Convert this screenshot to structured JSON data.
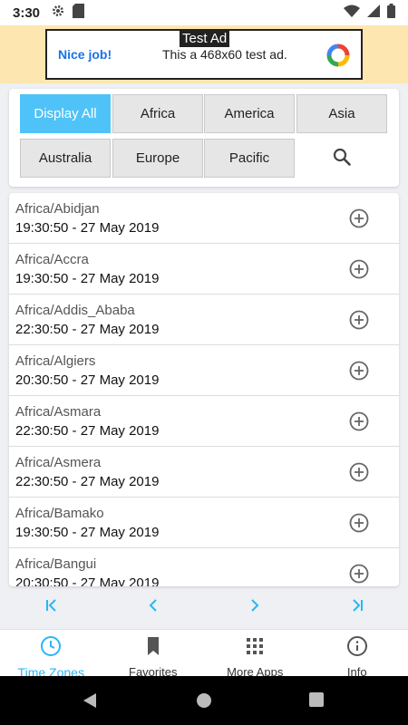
{
  "status_bar": {
    "time": "3:30"
  },
  "ad": {
    "label": "Test Ad",
    "headline": "Nice job!",
    "body": "This a 468x60 test ad."
  },
  "filters": {
    "buttons": [
      {
        "label": "Display All",
        "active": true
      },
      {
        "label": "Africa",
        "active": false
      },
      {
        "label": "America",
        "active": false
      },
      {
        "label": "Asia",
        "active": false
      },
      {
        "label": "Australia",
        "active": false
      },
      {
        "label": "Europe",
        "active": false
      },
      {
        "label": "Pacific",
        "active": false
      }
    ],
    "search_icon": "search-icon"
  },
  "timezones": [
    {
      "name": "Africa/Abidjan",
      "time": "19:30:50 - 27 May 2019"
    },
    {
      "name": "Africa/Accra",
      "time": "19:30:50 - 27 May 2019"
    },
    {
      "name": "Africa/Addis_Ababa",
      "time": "22:30:50 - 27 May 2019"
    },
    {
      "name": "Africa/Algiers",
      "time": "20:30:50 - 27 May 2019"
    },
    {
      "name": "Africa/Asmara",
      "time": "22:30:50 - 27 May 2019"
    },
    {
      "name": "Africa/Asmera",
      "time": "22:30:50 - 27 May 2019"
    },
    {
      "name": "Africa/Bamako",
      "time": "19:30:50 - 27 May 2019"
    },
    {
      "name": "Africa/Bangui",
      "time": "20:30:50 - 27 May 2019"
    }
  ],
  "pager": {
    "icons": [
      "first-page-icon",
      "previous-page-icon",
      "next-page-icon",
      "last-page-icon"
    ]
  },
  "bottom_nav": {
    "items": [
      {
        "label": "Time Zones",
        "icon": "clock-icon",
        "active": true
      },
      {
        "label": "Favorites",
        "icon": "bookmark-icon",
        "active": false
      },
      {
        "label": "More Apps",
        "icon": "apps-grid-icon",
        "active": false
      },
      {
        "label": "Info",
        "icon": "info-icon",
        "active": false
      }
    ]
  },
  "colors": {
    "accent": "#4fc3f7",
    "nav_active": "#29b6f6",
    "ad_background": "#fde6b0"
  }
}
